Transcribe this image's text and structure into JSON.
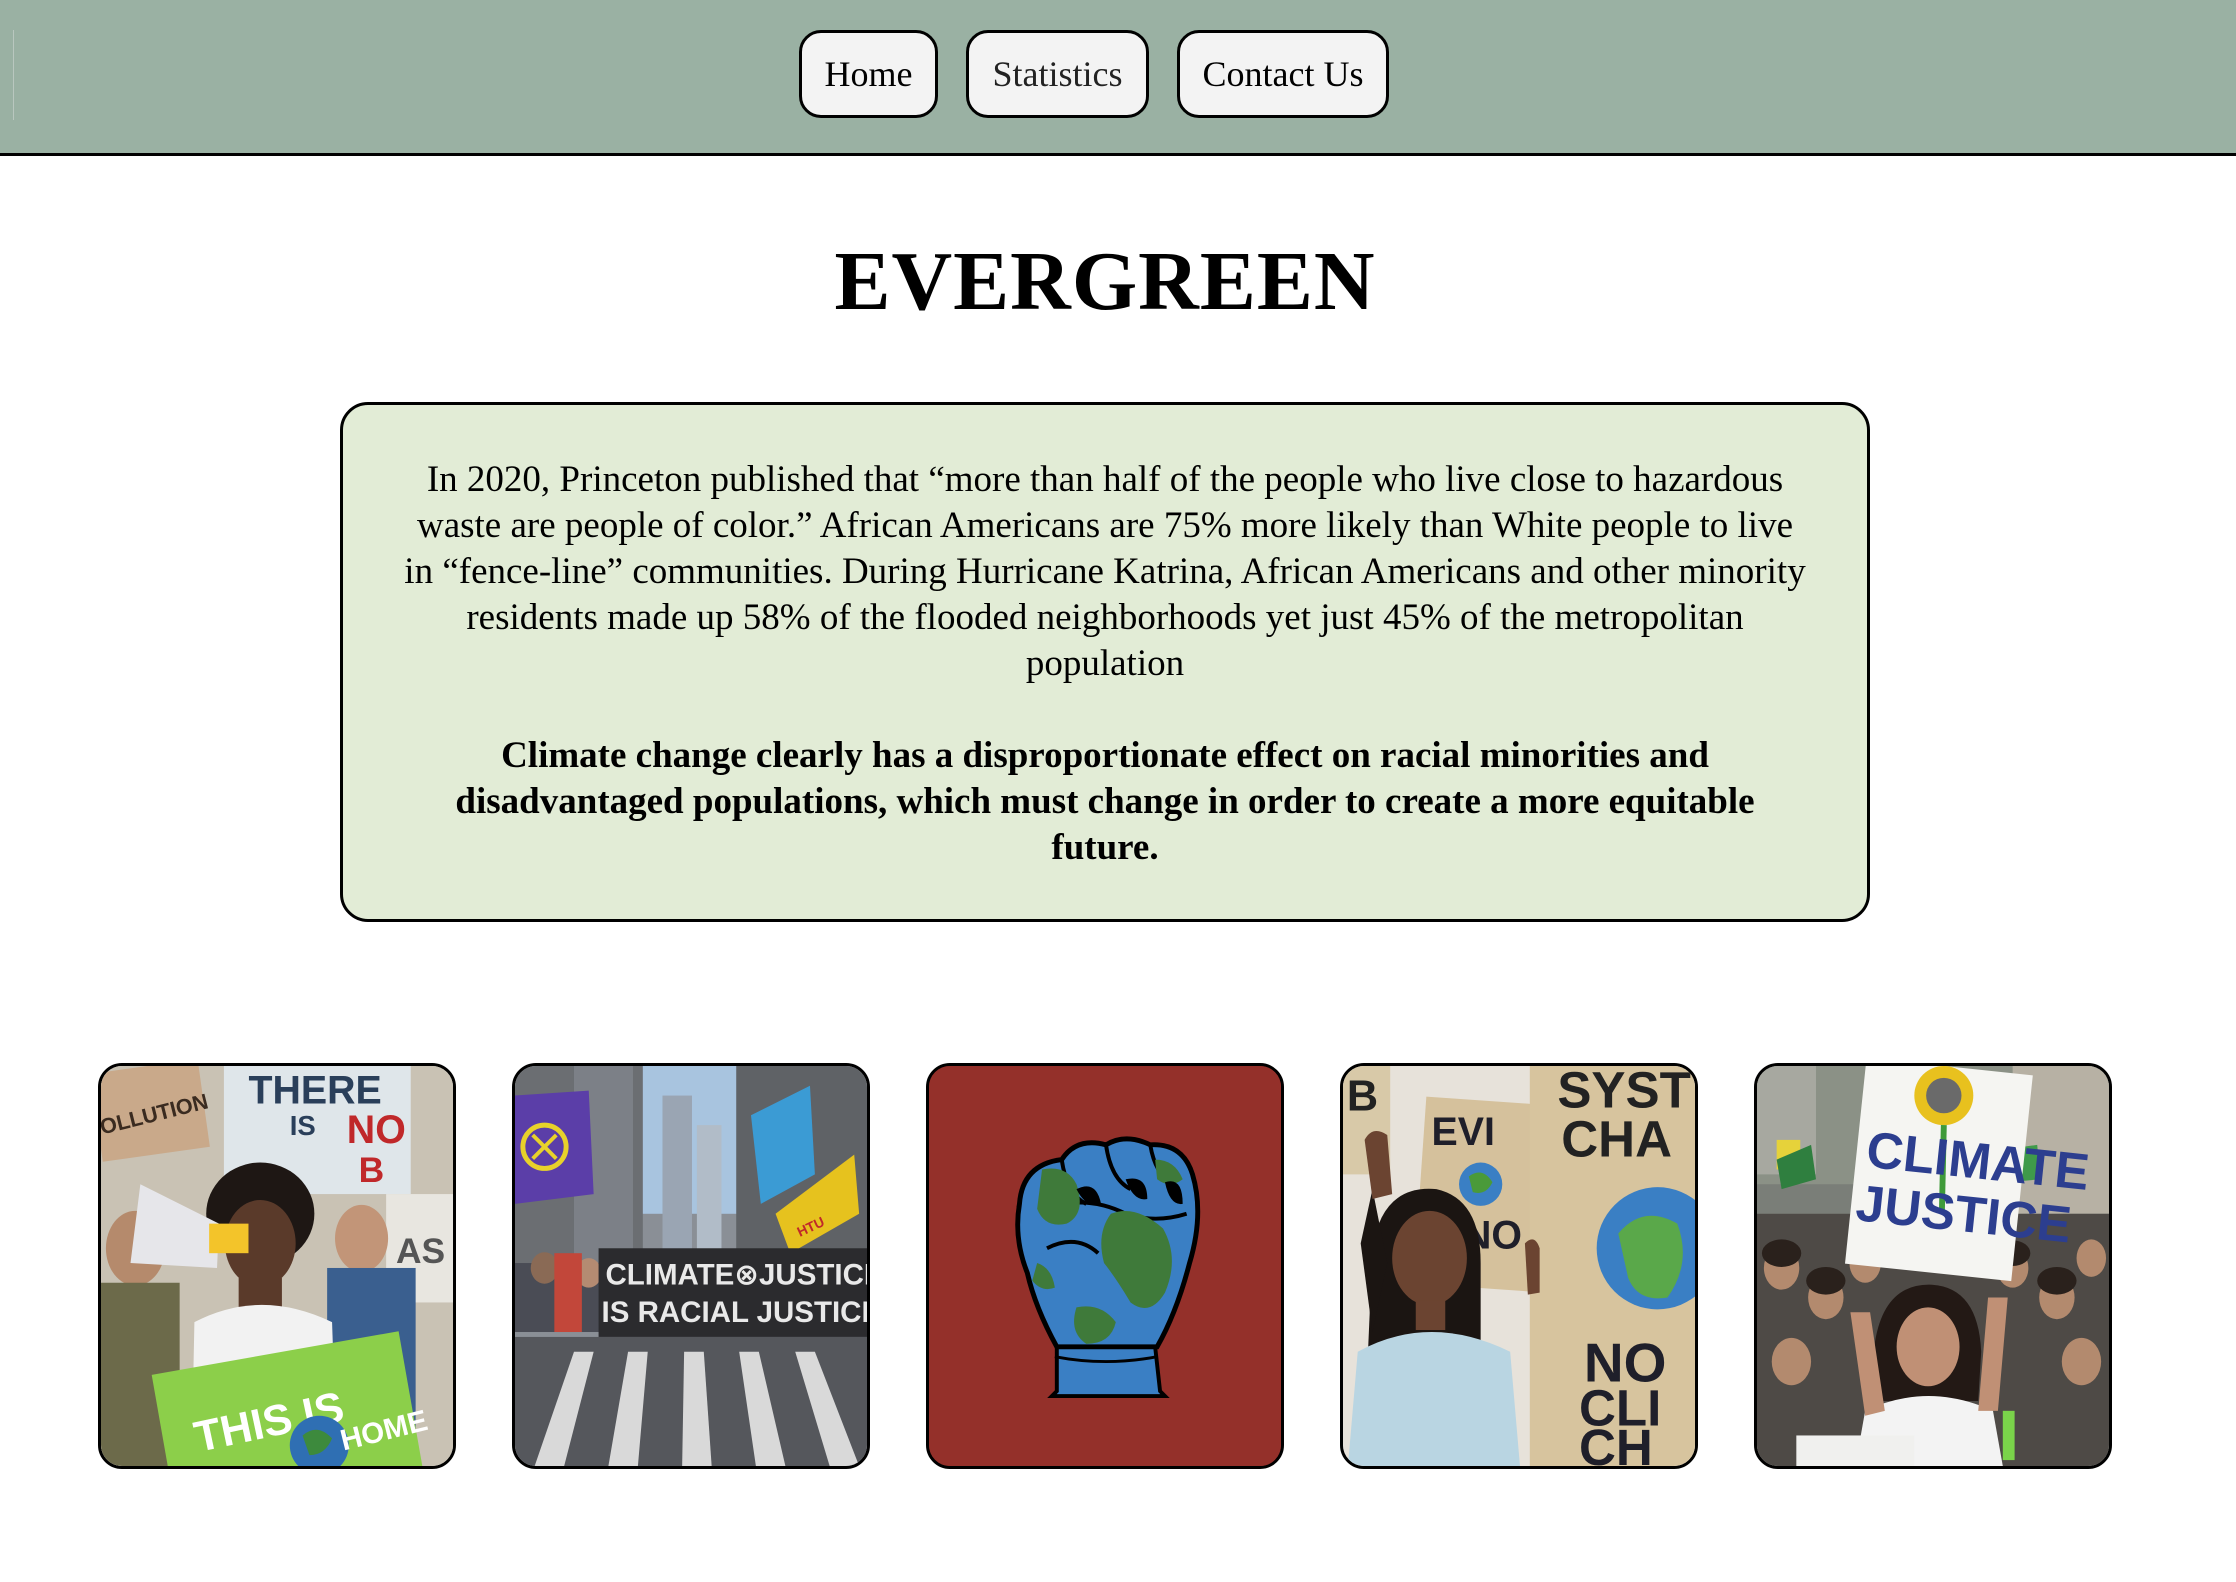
{
  "nav": {
    "items": [
      {
        "label": "Home"
      },
      {
        "label": "Statistics"
      },
      {
        "label": "Contact Us"
      }
    ]
  },
  "header": {
    "title": "EVERGREEN"
  },
  "info": {
    "paragraph": "In 2020, Princeton published that “more than half of the people who live close to hazardous waste are people of color.” African Americans are 75% more likely than White people to live in “fence-line” communities. During Hurricane Katrina, African Americans and other minority residents made up 58% of the flooded neighborhoods yet just 45% of the metropolitan population",
    "emphasis": "Climate change clearly has a disproportionate effect on racial minorities and disadvantaged populations, which must change in order to create a more equitable future."
  },
  "gallery": {
    "tiles": [
      {
        "signs": [
          "THERE",
          "IS",
          "NO",
          "B",
          "OLLUTION",
          "THIS IS",
          "HOME",
          "AS"
        ]
      },
      {
        "banner_line1": "CLIMATE⊗JUSTICE",
        "banner_line2": "IS RACIAL JUSTICE",
        "flag": "HTU"
      },
      {
        "icon": "earth-fist-icon",
        "background": "#94302a"
      },
      {
        "signs": [
          "SYST",
          "CHA",
          "EVI",
          "NO",
          "NO",
          "CLI",
          "CH",
          "B"
        ]
      },
      {
        "signs": [
          "CLIMATE",
          "JUSTICE"
        ]
      }
    ]
  },
  "colors": {
    "nav_bg": "#9ab1a3",
    "button_bg": "#f3f3f3",
    "info_bg": "#e2ecd6",
    "fist_tile_bg": "#94302a",
    "earth_blue": "#3a7fc4",
    "earth_green": "#3f7a3a"
  }
}
